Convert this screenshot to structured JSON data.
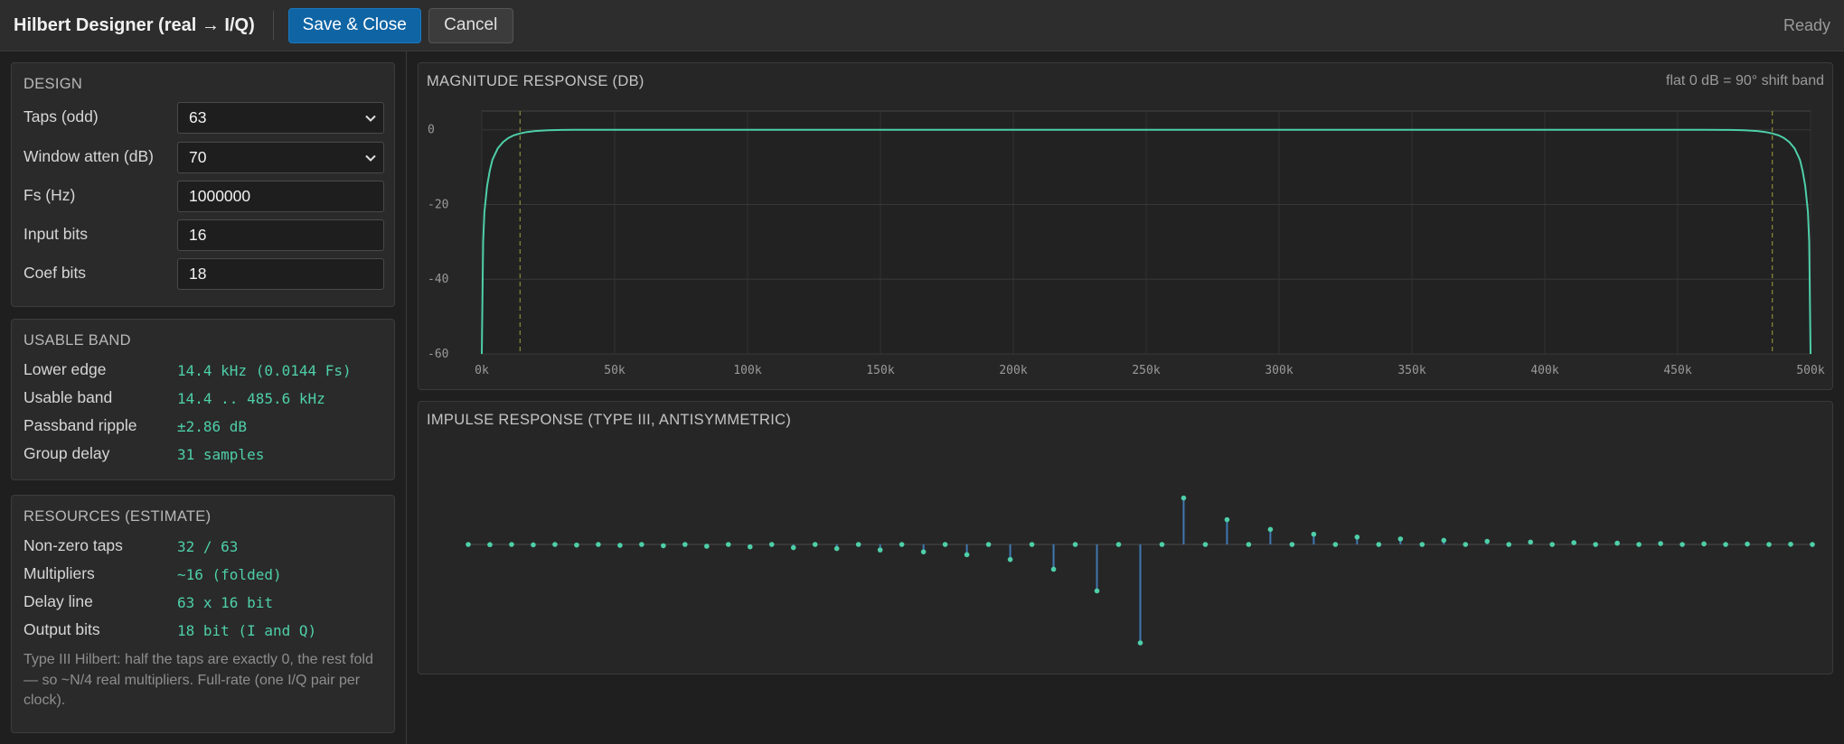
{
  "topbar": {
    "title": "Hilbert Designer (real → I/Q)",
    "save_label": "Save & Close",
    "cancel_label": "Cancel",
    "status": "Ready"
  },
  "design": {
    "title": "DESIGN",
    "taps_label": "Taps (odd)",
    "taps_value": "63",
    "atten_label": "Window atten (dB)",
    "atten_value": "70",
    "fs_label": "Fs (Hz)",
    "fs_value": "1000000",
    "input_bits_label": "Input bits",
    "input_bits_value": "16",
    "coef_bits_label": "Coef bits",
    "coef_bits_value": "18"
  },
  "usable": {
    "title": "USABLE BAND",
    "rows": [
      {
        "label": "Lower edge",
        "value": "14.4 kHz (0.0144 Fs)"
      },
      {
        "label": "Usable band",
        "value": "14.4 .. 485.6 kHz"
      },
      {
        "label": "Passband ripple",
        "value": "±2.86 dB"
      },
      {
        "label": "Group delay",
        "value": "31 samples"
      }
    ]
  },
  "resources": {
    "title": "RESOURCES (ESTIMATE)",
    "rows": [
      {
        "label": "Non-zero taps",
        "value": "32 / 63"
      },
      {
        "label": "Multipliers",
        "value": "~16 (folded)"
      },
      {
        "label": "Delay line",
        "value": "63 x 16 bit"
      },
      {
        "label": "Output bits",
        "value": "18 bit (I and Q)"
      }
    ],
    "note": "Type III Hilbert: half the taps are exactly 0, the rest fold — so ~N/4 real multipliers. Full-rate (one I/Q pair per clock)."
  },
  "colors": {
    "accent": "#4ecfa8",
    "stem": "#3f78b0",
    "primary_button": "#0f64a4",
    "marker": "#8a8a3a"
  },
  "chart_data": [
    {
      "type": "line",
      "title": "MAGNITUDE RESPONSE (DB)",
      "note": "flat 0 dB = 90° shift band",
      "x_tick_labels": [
        "0k",
        "50k",
        "100k",
        "150k",
        "200k",
        "250k",
        "300k",
        "350k",
        "400k",
        "450k",
        "500k"
      ],
      "y_tick_labels": [
        "0",
        "-20",
        "-40",
        "-60"
      ],
      "xlim": [
        0,
        500000
      ],
      "ylim": [
        -60,
        5
      ],
      "band_markers_hz": [
        14400,
        485600
      ],
      "series": [
        {
          "x": [
            0,
            500,
            1000,
            2000,
            3000,
            4000,
            6000,
            8000,
            10000,
            12000,
            14400,
            17000,
            20000,
            25000,
            30000,
            40000,
            50000,
            250000,
            450000,
            460000,
            470000,
            475000,
            480000,
            483000,
            485600,
            488000,
            490000,
            492000,
            494000,
            496000,
            497000,
            498000,
            499000,
            499500,
            500000
          ],
          "y": [
            -60,
            -30,
            -22,
            -15,
            -11,
            -8,
            -5,
            -3.3,
            -2.2,
            -1.5,
            -1.0,
            -0.6,
            -0.35,
            -0.12,
            -0.04,
            -0.01,
            0,
            0,
            0,
            -0.01,
            -0.04,
            -0.12,
            -0.35,
            -0.6,
            -1.0,
            -1.5,
            -2.2,
            -3.3,
            -5,
            -8,
            -11,
            -15,
            -22,
            -30,
            -60
          ]
        }
      ]
    },
    {
      "type": "stem",
      "title": "IMPULSE RESPONSE (TYPE III, ANTISYMMETRIC)",
      "x": [
        0,
        1,
        2,
        3,
        4,
        5,
        6,
        7,
        8,
        9,
        10,
        11,
        12,
        13,
        14,
        15,
        16,
        17,
        18,
        19,
        20,
        21,
        22,
        23,
        24,
        25,
        26,
        27,
        28,
        29,
        30,
        31,
        32,
        33,
        34,
        35,
        36,
        37,
        38,
        39,
        40,
        41,
        42,
        43,
        44,
        45,
        46,
        47,
        48,
        49,
        50,
        51,
        52,
        53,
        54,
        55,
        56,
        57,
        58,
        59,
        60,
        61,
        62
      ],
      "y": [
        0,
        -0.002,
        0,
        -0.004,
        0,
        -0.006,
        0,
        -0.009,
        0,
        -0.013,
        0,
        -0.018,
        0,
        -0.024,
        0,
        -0.032,
        0,
        -0.042,
        0,
        -0.056,
        0,
        -0.075,
        0,
        -0.104,
        0,
        -0.153,
        0,
        -0.252,
        0,
        -0.472,
        0,
        -1,
        0,
        0.472,
        0,
        0.252,
        0,
        0.153,
        0,
        0.104,
        0,
        0.075,
        0,
        0.056,
        0,
        0.042,
        0,
        0.032,
        0,
        0.024,
        0,
        0.018,
        0,
        0.013,
        0,
        0.009,
        0,
        0.006,
        0,
        0.004,
        0,
        0.002,
        0
      ]
    }
  ]
}
